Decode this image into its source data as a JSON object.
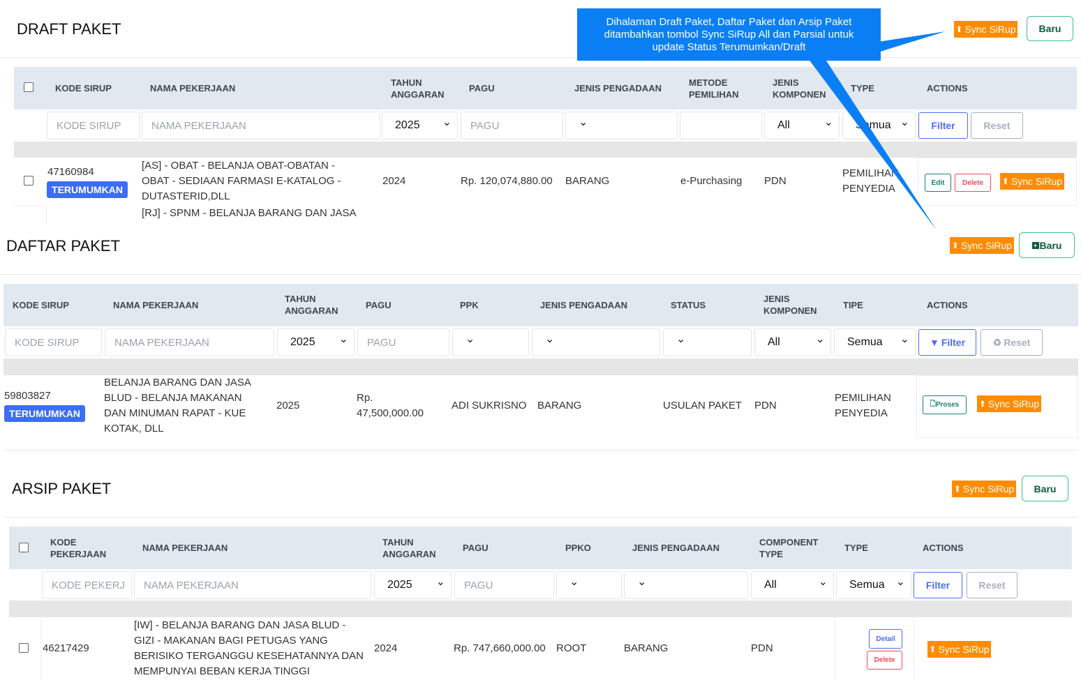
{
  "callout": {
    "line1": "Dihalaman Draft Paket, Daftar Paket dan Arsip Paket",
    "line2": "ditambahkan tombol Sync SiRup All dan Parsial untuk",
    "line3": "update Status Terumumkan/Draft",
    "color": "#0a7ff5"
  },
  "colors": {
    "sync": "#ff8c00",
    "badge": "#3b6ef5",
    "filter": "#4a6cf7",
    "baru_border": "#3fc08a"
  },
  "draft": {
    "title": "DRAFT PAKET",
    "sync_label": "Sync SiRup",
    "baru_label": "Baru",
    "headers": [
      "KODE SIRUP",
      "NAMA PEKERJAAN",
      "TAHUN ANGGARAN",
      "PAGU",
      "JENIS PENGADAAN",
      "METODE PEMILIHAN",
      "JENIS KOMPONEN",
      "TYPE",
      "ACTIONS"
    ],
    "filters": {
      "kode_placeholder": "KODE SIRUP",
      "nama_placeholder": "NAMA PEKERJAAN",
      "tahun": "2025",
      "pagu_placeholder": "PAGU",
      "jenis": "",
      "metode": "",
      "komponen": "All",
      "type": "Semua",
      "filter_label": "Filter",
      "reset_label": "Reset"
    },
    "row": {
      "kode": "47160984",
      "status": "TERUMUMKAN",
      "nama": [
        "[AS] - OBAT - BELANJA OBAT-OBATAN -",
        "OBAT - SEDIAAN FARMASI E-KATALOG -",
        "DUTASTERID,DLL"
      ],
      "tahun": "2024",
      "pagu": "Rp. 120,074,880.00",
      "jenis": "BARANG",
      "metode": "e-Purchasing",
      "komponen": "PDN",
      "type": [
        "PEMILIHAN",
        "PENYEDIA"
      ],
      "edit": "Edit",
      "delete": "Delete",
      "sync": "Sync SiRup"
    },
    "next_row_nama": "[RJ] - SPNM - BELANJA BARANG DAN JASA"
  },
  "daftar": {
    "title": "DAFTAR PAKET",
    "sync_label": "Sync SiRup",
    "baru_label": "Baru",
    "headers": [
      "KODE SIRUP",
      "NAMA PEKERJAAN",
      "TAHUN ANGGARAN",
      "PAGU",
      "PPK",
      "JENIS PENGADAAN",
      "STATUS",
      "JENIS KOMPONEN",
      "TIPE",
      "ACTIONS"
    ],
    "filters": {
      "kode_placeholder": "KODE SIRUP",
      "nama_placeholder": "NAMA PEKERJAAN",
      "tahun": "2025",
      "pagu_placeholder": "PAGU",
      "ppk": "",
      "jenis": "",
      "status": "",
      "komponen": "All",
      "tipe": "Semua",
      "filter_label": "Filter",
      "reset_label": "Reset"
    },
    "row": {
      "kode": "59803827",
      "status_badge": "TERUMUMKAN",
      "nama": [
        "BELANJA BARANG DAN JASA",
        "BLUD - BELANJA MAKANAN",
        "DAN MINUMAN RAPAT - KUE",
        "KOTAK, DLL"
      ],
      "tahun": "2025",
      "pagu": [
        "Rp.",
        "47,500,000.00"
      ],
      "ppk": "ADI SUKRISNO",
      "jenis": "BARANG",
      "status": "USULAN PAKET",
      "komponen": "PDN",
      "tipe": [
        "PEMILIHAN",
        "PENYEDIA"
      ],
      "proses": "Proses",
      "sync": "Sync SiRup"
    }
  },
  "arsip": {
    "title": "ARSIP PAKET",
    "sync_label": "Sync SiRup",
    "baru_label": "Baru",
    "headers": [
      "KODE PEKERJAAN",
      "NAMA PEKERJAAN",
      "TAHUN ANGGARAN",
      "PAGU",
      "PPKO",
      "JENIS PENGADAAN",
      "COMPONENT TYPE",
      "TYPE",
      "ACTIONS"
    ],
    "filters": {
      "kode_placeholder": "KODE PEKERJ",
      "nama_placeholder": "NAMA PEKERJAAN",
      "tahun": "2025",
      "pagu_placeholder": "PAGU",
      "ppko": "",
      "jenis": "",
      "component": "All",
      "type": "Semua",
      "filter_label": "Filter",
      "reset_label": "Reset"
    },
    "row": {
      "kode": "46217429",
      "nama": [
        "[IW] - BELANJA BARANG DAN JASA BLUD -",
        "GIZI - MAKANAN BAGI PETUGAS YANG",
        "BERISIKO TERGANGGU KESEHATANNYA DAN",
        "MEMPUNYAI BEBAN KERJA TINGGI"
      ],
      "tahun": "2024",
      "pagu": "Rp. 747,660,000.00",
      "ppko": "ROOT",
      "jenis": "BARANG",
      "component": "PDN",
      "detail": "Detail",
      "delete": "Delete",
      "sync": "Sync SiRup"
    }
  }
}
